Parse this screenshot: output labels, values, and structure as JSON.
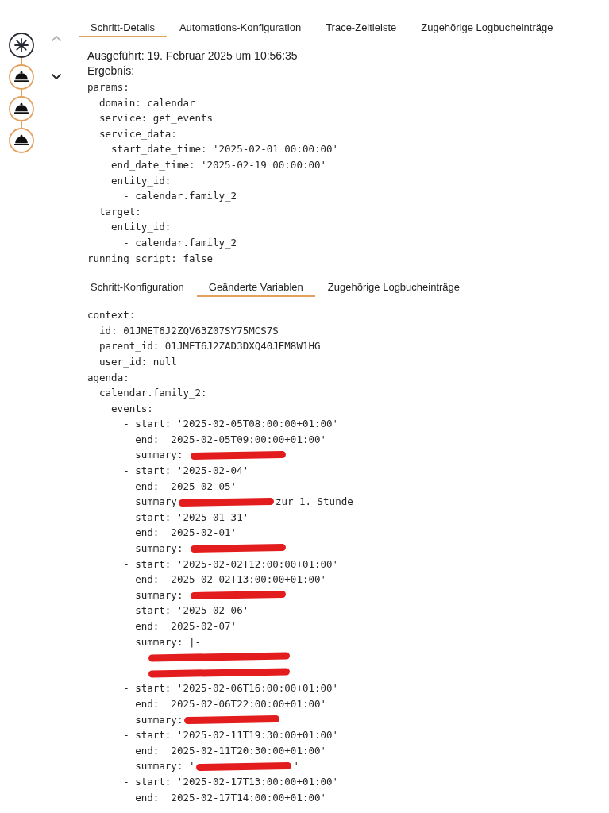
{
  "timeline": {
    "nodes": [
      {
        "kind": "trigger",
        "tracked": false
      },
      {
        "kind": "action",
        "tracked": true
      },
      {
        "kind": "action",
        "tracked": true
      },
      {
        "kind": "action",
        "tracked": true
      }
    ],
    "scroll_up": {
      "disabled": true
    },
    "scroll_down": {
      "disabled": false
    }
  },
  "tabs": [
    {
      "label": "Schritt-Details",
      "selected": true
    },
    {
      "label": "Automations-Konfiguration",
      "selected": false
    },
    {
      "label": "Trace-Zeitleiste",
      "selected": false
    },
    {
      "label": "Zugehörige Logbucheinträge",
      "selected": false
    }
  ],
  "step_details": {
    "executed": "Ausgeführt: 19. Februar 2025 um 10:56:35",
    "result_label": "Ergebnis:",
    "result": [
      {
        "text": "params:",
        "children": [
          {
            "text": "domain: calendar"
          },
          {
            "text": "service: get_events"
          },
          {
            "text": "service_data:",
            "children": [
              {
                "text": "start_date_time: '2025-02-01 00:00:00'"
              },
              {
                "text": "end_date_time: '2025-02-19 00:00:00'"
              },
              {
                "text": "entity_id:",
                "children": [
                  {
                    "text": "- calendar.family_2"
                  }
                ]
              }
            ]
          },
          {
            "text": "target:",
            "children": [
              {
                "text": "entity_id:",
                "children": [
                  {
                    "text": "- calendar.family_2"
                  }
                ]
              }
            ]
          }
        ]
      },
      {
        "text": "running_script: false"
      }
    ]
  },
  "sub_tabs": [
    {
      "label": "Schritt-Konfiguration",
      "selected": false
    },
    {
      "label": "Geänderte Variablen",
      "selected": true
    },
    {
      "label": "Zugehörige Logbucheinträge",
      "selected": false
    }
  ],
  "changed_variables": [
    {
      "text": "context:",
      "children": [
        {
          "text": "id: 01JMET6J2ZQV63Z07SY75MCS7S"
        },
        {
          "text": "parent_id: 01JMET6J2ZAD3DXQ40JEM8W1HG"
        },
        {
          "text": "user_id: null"
        }
      ]
    },
    {
      "text": "agenda:",
      "children": [
        {
          "text": "calendar.family_2:",
          "children": [
            {
              "text": "events:",
              "children": [
                {
                  "text": "- start: '2025-02-05T08:00:00+01:00'",
                  "children": [
                    {
                      "text": "end: '2025-02-05T09:00:00+01:00'"
                    },
                    {
                      "segments": [
                        {
                          "kind": "text",
                          "text": "summary: "
                        },
                        {
                          "kind": "redaction"
                        }
                      ]
                    }
                  ]
                },
                {
                  "text": "- start: '2025-02-04'",
                  "children": [
                    {
                      "text": "end: '2025-02-05'"
                    },
                    {
                      "segments": [
                        {
                          "kind": "text",
                          "text": "summary"
                        },
                        {
                          "kind": "redaction"
                        },
                        {
                          "kind": "text",
                          "text": "zur 1. Stunde"
                        }
                      ]
                    }
                  ]
                },
                {
                  "text": "- start: '2025-01-31'",
                  "children": [
                    {
                      "text": "end: '2025-02-01'"
                    },
                    {
                      "segments": [
                        {
                          "kind": "text",
                          "text": "summary: "
                        },
                        {
                          "kind": "redaction"
                        }
                      ]
                    }
                  ]
                },
                {
                  "text": "- start: '2025-02-02T12:00:00+01:00'",
                  "children": [
                    {
                      "text": "end: '2025-02-02T13:00:00+01:00'"
                    },
                    {
                      "segments": [
                        {
                          "kind": "text",
                          "text": "summary: "
                        },
                        {
                          "kind": "redaction"
                        }
                      ]
                    }
                  ]
                },
                {
                  "text": "- start: '2025-02-06'",
                  "children": [
                    {
                      "text": "end: '2025-02-07'"
                    },
                    {
                      "text": "summary: |-",
                      "children": [
                        {
                          "segments": [
                            {
                              "kind": "redaction"
                            }
                          ]
                        },
                        {
                          "segments": [
                            {
                              "kind": "redaction"
                            }
                          ]
                        }
                      ]
                    }
                  ]
                },
                {
                  "text": "- start: '2025-02-06T16:00:00+01:00'",
                  "children": [
                    {
                      "text": "end: '2025-02-06T22:00:00+01:00'"
                    },
                    {
                      "segments": [
                        {
                          "kind": "text",
                          "text": "summary:"
                        },
                        {
                          "kind": "redaction"
                        }
                      ]
                    }
                  ]
                },
                {
                  "text": "- start: '2025-02-11T19:30:00+01:00'",
                  "children": [
                    {
                      "text": "end: '2025-02-11T20:30:00+01:00'"
                    },
                    {
                      "segments": [
                        {
                          "kind": "text",
                          "text": "summary: '"
                        },
                        {
                          "kind": "redaction"
                        },
                        {
                          "kind": "text",
                          "text": "'"
                        }
                      ]
                    }
                  ]
                },
                {
                  "text": "- start: '2025-02-17T13:00:00+01:00'",
                  "children": [
                    {
                      "text": "end: '2025-02-17T14:00:00+01:00'"
                    }
                  ]
                }
              ]
            }
          ]
        }
      ]
    }
  ]
}
